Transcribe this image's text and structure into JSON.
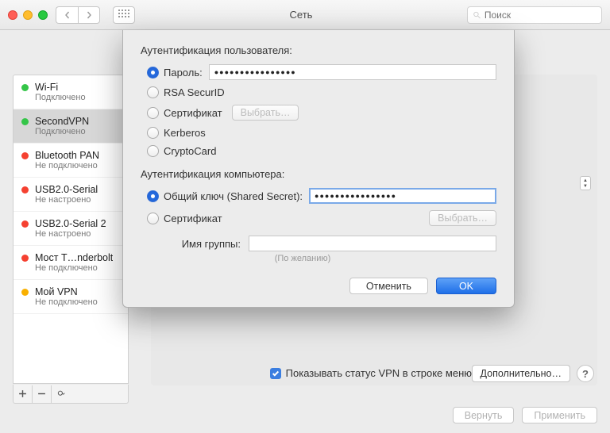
{
  "window": {
    "title": "Сеть",
    "search_placeholder": "Поиск"
  },
  "sidebar": {
    "items": [
      {
        "name": "Wi-Fi",
        "status": "Подключено",
        "dot": "s-green"
      },
      {
        "name": "SecondVPN",
        "status": "Подключено",
        "dot": "s-green"
      },
      {
        "name": "Bluetooth PAN",
        "status": "Не подключено",
        "dot": "s-red"
      },
      {
        "name": "USB2.0-Serial",
        "status": "Не настроено",
        "dot": "s-red"
      },
      {
        "name": "USB2.0-Serial 2",
        "status": "Не настроено",
        "dot": "s-red"
      },
      {
        "name": "Мост T…nderbolt",
        "status": "Не подключено",
        "dot": "s-red"
      },
      {
        "name": "Мой VPN",
        "status": "Не подключено",
        "dot": "s-orange"
      }
    ]
  },
  "right": {
    "show_status": "Показывать статус VPN в строке меню",
    "advanced": "Дополнительно…"
  },
  "footer": {
    "revert": "Вернуть",
    "apply": "Применить"
  },
  "sheet": {
    "user_auth_title": "Аутентификация пользователя:",
    "radios": {
      "password": "Пароль:",
      "rsa": "RSA SecurID",
      "cert": "Сертификат",
      "kerberos": "Kerberos",
      "crypto": "CryptoCard"
    },
    "password_value": "●●●●●●●●●●●●●●●●",
    "choose": "Выбрать…",
    "machine_auth_title": "Аутентификация компьютера:",
    "m_radios": {
      "shared": "Общий ключ (Shared Secret):",
      "cert": "Сертификат"
    },
    "shared_value": "●●●●●●●●●●●●●●●●",
    "group_label": "Имя группы:",
    "group_hint": "(По желанию)",
    "cancel": "Отменить",
    "ok": "OK"
  }
}
